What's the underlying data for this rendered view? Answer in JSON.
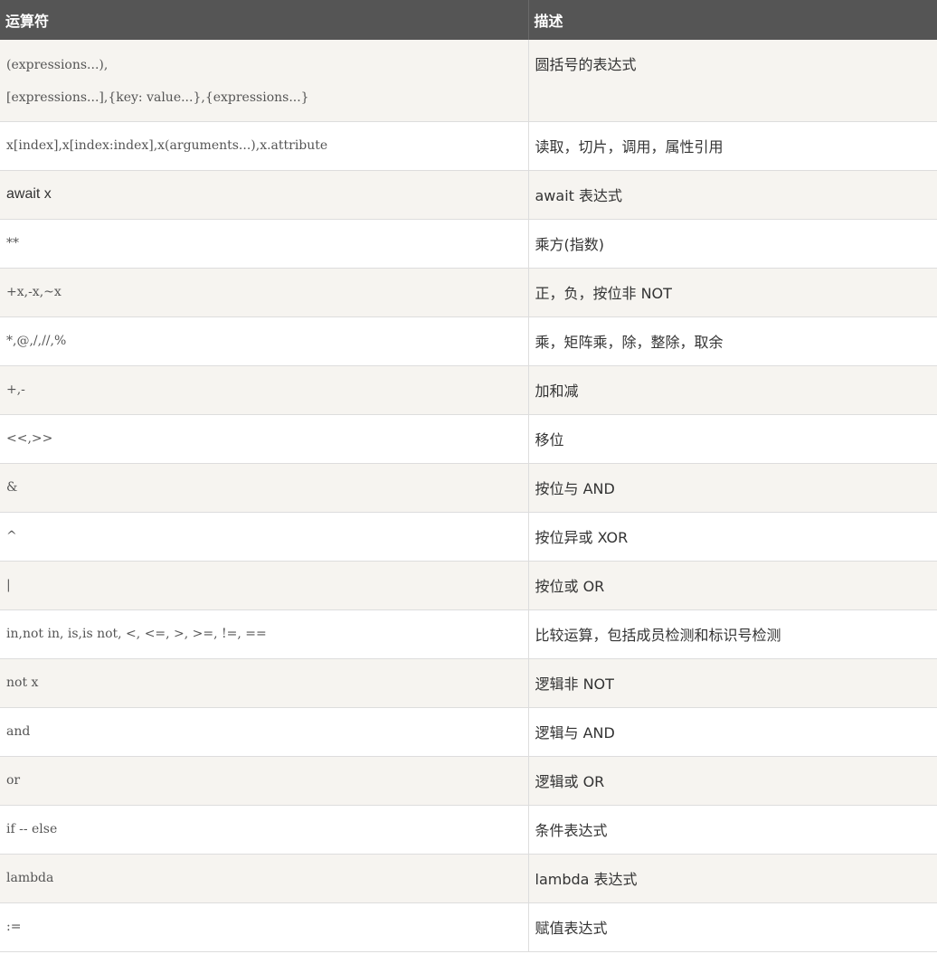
{
  "table": {
    "headers": {
      "operator": "运算符",
      "description": "描述"
    },
    "rows": [
      {
        "operator_lines": [
          "(expressions...),",
          "[expressions...],{key: value...},{expressions...}"
        ],
        "description": "圆括号的表达式"
      },
      {
        "operator": "x[index],x[index:index],x(arguments...),x.attribute",
        "description": "读取，切片，调用，属性引用"
      },
      {
        "operator": "await x",
        "description": "await 表达式"
      },
      {
        "operator": "**",
        "description": "乘方(指数)"
      },
      {
        "operator": "+x,-x,~x",
        "description": "正，负，按位非 NOT"
      },
      {
        "operator": "*,@,/,//,%",
        "description": "乘，矩阵乘，除，整除，取余"
      },
      {
        "operator": "+,-",
        "description": "加和减"
      },
      {
        "operator": "<<,>>",
        "description": "移位"
      },
      {
        "operator": "&",
        "description": "按位与 AND"
      },
      {
        "operator": "^",
        "description": "按位异或 XOR"
      },
      {
        "operator": "|",
        "description": "按位或 OR"
      },
      {
        "operator": "in,not in, is,is not, <, <=, >, >=, !=, ==",
        "description": "比较运算，包括成员检测和标识号检测"
      },
      {
        "operator": "not x",
        "description": "逻辑非 NOT"
      },
      {
        "operator": "and",
        "description": "逻辑与 AND"
      },
      {
        "operator": "or",
        "description": "逻辑或 OR"
      },
      {
        "operator": "if -- else",
        "description": "条件表达式"
      },
      {
        "operator": "lambda",
        "description": "lambda 表达式"
      },
      {
        "operator": ":=",
        "description": "赋值表达式"
      }
    ]
  }
}
